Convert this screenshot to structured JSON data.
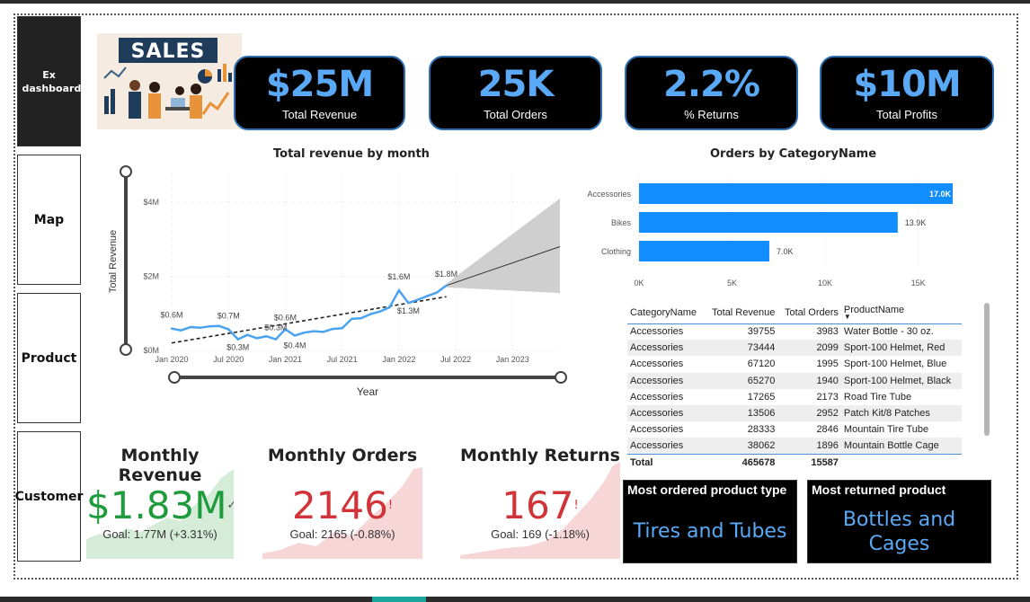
{
  "nav": {
    "items": [
      {
        "label": "Ex dashboard",
        "active": true
      },
      {
        "label": "Map",
        "active": false
      },
      {
        "label": "Product",
        "active": false
      },
      {
        "label": "Customer",
        "active": false
      }
    ]
  },
  "logo": {
    "text": "SALES"
  },
  "kpis": [
    {
      "value": "$25M",
      "label": "Total Revenue"
    },
    {
      "value": "25K",
      "label": "Total Orders"
    },
    {
      "value": "2.2%",
      "label": "% Returns"
    },
    {
      "value": "$10M",
      "label": "Total Profits"
    }
  ],
  "line_chart": {
    "title": "Total revenue by month",
    "ylabel": "Total Revenue",
    "xlabel": "Year",
    "y_ticks": [
      "$0M",
      "$2M",
      "$4M"
    ],
    "x_ticks": [
      "Jan 2020",
      "Jul 2020",
      "Jan 2021",
      "Jul 2021",
      "Jan 2022",
      "Jul 2022",
      "Jan 2023"
    ],
    "data_labels": [
      "$0.6M",
      "$0.7M",
      "$0.3M",
      "$0.3M",
      "$0.6M",
      "$0.4M",
      "$1.6M",
      "$1.3M",
      "$1.8M"
    ]
  },
  "bar_chart": {
    "title": "Orders by CategoryName",
    "x_ticks": [
      "0K",
      "5K",
      "10K",
      "15K"
    ],
    "data_labels": [
      "17.0K",
      "13.9K",
      "7.0K"
    ]
  },
  "chart_data": [
    {
      "type": "line",
      "title": "Total revenue by month",
      "xlabel": "Year",
      "ylabel": "Total Revenue",
      "x_range": [
        "2020-01",
        "2023-06"
      ],
      "ylim": [
        0,
        4.8
      ],
      "series": [
        {
          "x": [
            "2020-01",
            "2020-02",
            "2020-03",
            "2020-04",
            "2020-05",
            "2020-06",
            "2020-07",
            "2020-08",
            "2020-09",
            "2020-10",
            "2020-11",
            "2020-12",
            "2021-01",
            "2021-02",
            "2021-03",
            "2021-04",
            "2021-05",
            "2021-06",
            "2021-07",
            "2021-08",
            "2021-09",
            "2021-10",
            "2021-11",
            "2021-12",
            "2022-01",
            "2022-02",
            "2022-03",
            "2022-04",
            "2022-05",
            "2022-06"
          ],
          "values": [
            0.59,
            0.54,
            0.63,
            0.61,
            0.65,
            0.66,
            0.57,
            0.3,
            0.42,
            0.33,
            0.38,
            0.3,
            0.57,
            0.4,
            0.48,
            0.52,
            0.5,
            0.58,
            0.6,
            0.85,
            0.87,
            0.98,
            1.05,
            1.16,
            1.62,
            1.28,
            1.37,
            1.47,
            1.56,
            1.75
          ]
        }
      ],
      "forecast": {
        "x": [
          "2022-06",
          "2023-06"
        ],
        "values": [
          1.75,
          2.8
        ],
        "upper": [
          1.8,
          4.1
        ],
        "lower": [
          1.7,
          1.55
        ]
      },
      "trend": {
        "x": [
          "2020-01",
          "2022-06"
        ],
        "values": [
          0.2,
          1.45
        ]
      }
    },
    {
      "type": "bar",
      "orientation": "horizontal",
      "title": "Orders by CategoryName",
      "categories": [
        "Accessories",
        "Bikes",
        "Clothing"
      ],
      "values": [
        17000,
        13900,
        7000
      ],
      "xlim": [
        0,
        17000
      ],
      "color": "#118dff"
    }
  ],
  "table": {
    "columns": [
      "CategoryName",
      "Total Revenue",
      "Total Orders",
      "ProductName"
    ],
    "rows": [
      [
        "Accessories",
        "39755",
        "3983",
        "Water Bottle - 30 oz."
      ],
      [
        "Accessories",
        "73444",
        "2099",
        "Sport-100 Helmet, Red"
      ],
      [
        "Accessories",
        "67120",
        "1995",
        "Sport-100 Helmet, Blue"
      ],
      [
        "Accessories",
        "65270",
        "1940",
        "Sport-100 Helmet, Black"
      ],
      [
        "Accessories",
        "17265",
        "2173",
        "Road Tire Tube"
      ],
      [
        "Accessories",
        "13506",
        "2952",
        "Patch Kit/8 Patches"
      ],
      [
        "Accessories",
        "28333",
        "2846",
        "Mountain Tire Tube"
      ],
      [
        "Accessories",
        "38062",
        "1896",
        "Mountain Bottle Cage"
      ]
    ],
    "total": [
      "Total",
      "465678",
      "15587",
      ""
    ]
  },
  "cards": [
    {
      "title": "Monthly Revenue",
      "value": "$1.83M",
      "goal": "Goal: 1.77M (+3.31%)",
      "status": "✓",
      "color": "#1e9b3c",
      "fill": "#d5ecd9"
    },
    {
      "title": "Monthly Orders",
      "value": "2146",
      "goal": "Goal: 2165 (-0.88%)",
      "status": "!",
      "color": "#d13438",
      "fill": "#f7d6d8"
    },
    {
      "title": "Monthly Returns",
      "value": "167",
      "goal": "Goal: 169 (-1.18%)",
      "status": "!",
      "color": "#d13438",
      "fill": "#f7d6d8"
    }
  ],
  "highlights": [
    {
      "title": "Most ordered product type",
      "value": "Tires and Tubes"
    },
    {
      "title": "Most returned product",
      "value": "Bottles and Cages"
    }
  ],
  "colors": {
    "kpi_value": "#5aa9f6",
    "kpi_border": "#2d6fb2",
    "bar": "#118dff",
    "line": "#4aa3ee"
  }
}
